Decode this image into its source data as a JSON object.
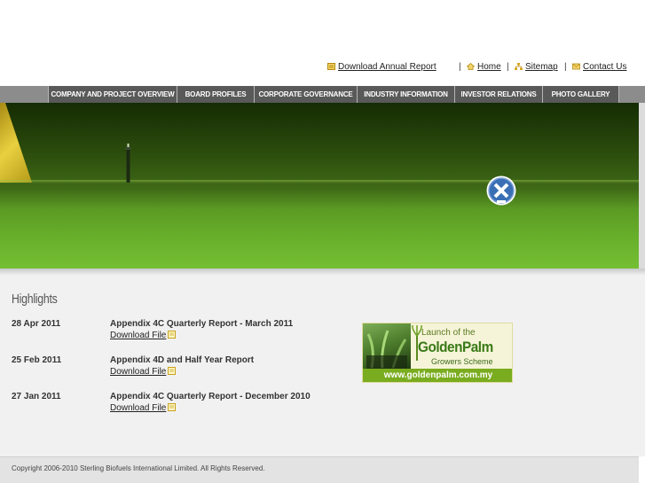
{
  "top_links": {
    "annual_report": "Download Annual Report",
    "separator": "|",
    "home": "Home",
    "sitemap": "Sitemap",
    "contact": "Contact Us"
  },
  "nav": {
    "items": [
      {
        "label": "COMPANY AND PROJECT OVERVIEW"
      },
      {
        "label": "BOARD PROFILES"
      },
      {
        "label": "CORPORATE GOVERNANCE"
      },
      {
        "label": "INDUSTRY INFORMATION"
      },
      {
        "label": "INVESTOR RELATIONS"
      },
      {
        "label": "PHOTO GALLERY"
      }
    ]
  },
  "highlights": {
    "heading": "Highlights",
    "download_label": "Download File",
    "items": [
      {
        "date": "28 Apr 2011",
        "title": "Appendix 4C Quarterly Report - March 2011"
      },
      {
        "date": "25 Feb 2011",
        "title": "Appendix 4D and Half Year Report"
      },
      {
        "date": "27 Jan 2011",
        "title": "Appendix 4C Quarterly Report - December 2010"
      }
    ]
  },
  "promo": {
    "line1": "Launch of the",
    "line2": "GoldenPalm",
    "line3": "Growers Scheme",
    "url": "www.goldenpalm.com.my"
  },
  "footer": {
    "copyright": "Copyright 2006-2010 Sterling Biofuels International Limited. All Rights Reserved."
  },
  "colors": {
    "nav_bg": "#595959",
    "nav_strip": "#8c8c8c",
    "promo_green": "#7aac1f",
    "banner_green": "#67ae2a"
  }
}
